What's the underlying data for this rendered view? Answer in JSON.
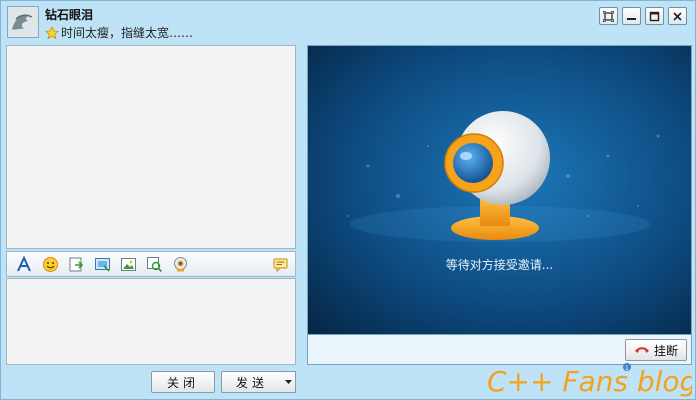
{
  "contact": {
    "name": "钻石眼泪",
    "status": "时间太瘦，指缝太宽……"
  },
  "window_buttons": [
    "pin",
    "minimize",
    "maximize",
    "close"
  ],
  "chat": {
    "toolbar_icons": [
      "font-icon",
      "emoji-icon",
      "send-file-icon",
      "screenshot-icon",
      "image-icon",
      "scan-icon",
      "camera-icon",
      "message-history-icon"
    ]
  },
  "buttons": {
    "close": "关闭",
    "send": "发送"
  },
  "video": {
    "waiting_text": "等待对方接受邀请...",
    "hangup": "挂断"
  },
  "watermark": {
    "text": "C++ Fans blog"
  },
  "colors": {
    "window_bg": "#bfe3f6",
    "video_bg": "#0c3c66",
    "accent_orange": "#f7a21b"
  }
}
